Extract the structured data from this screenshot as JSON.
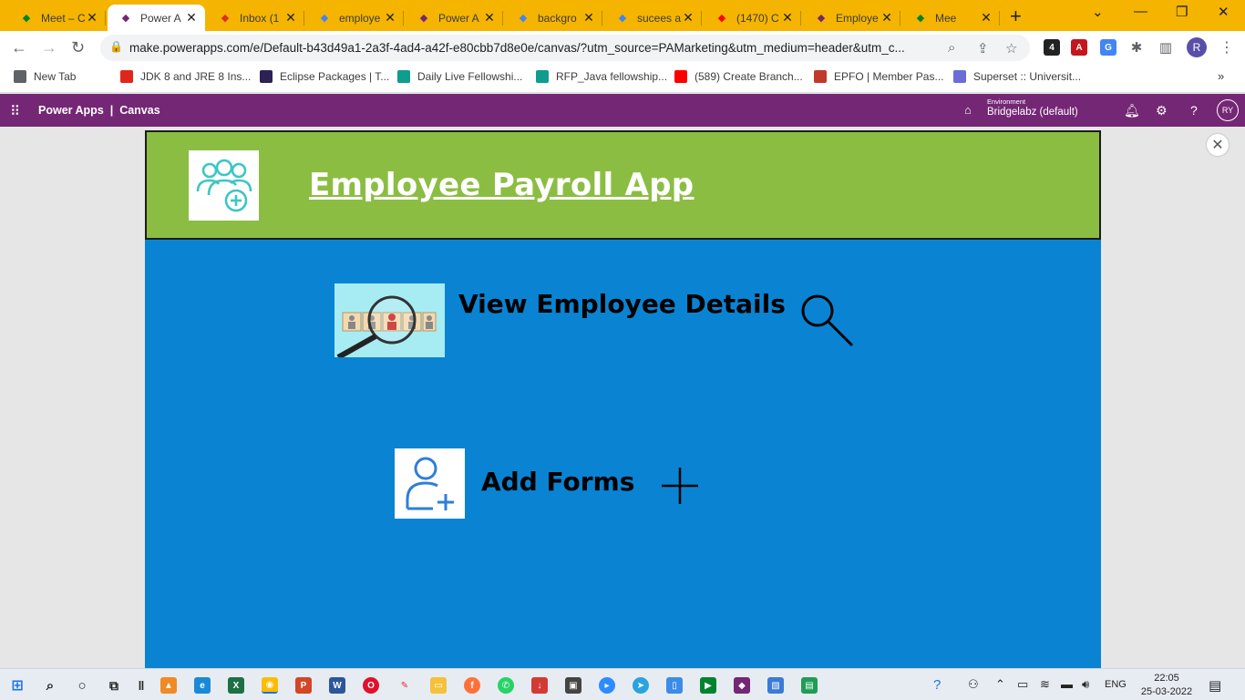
{
  "browser": {
    "tabs": [
      {
        "title": "Meet – C",
        "icon": "meet-icon",
        "color": "#00832d",
        "active": false
      },
      {
        "title": "Power A",
        "icon": "powerapps-icon",
        "color": "#742774",
        "active": true
      },
      {
        "title": "Inbox (1",
        "icon": "gmail-icon",
        "color": "#d93025",
        "active": false
      },
      {
        "title": "employe",
        "icon": "google-icon",
        "color": "#4285f4",
        "active": false
      },
      {
        "title": "Power A",
        "icon": "powerapps-icon",
        "color": "#742774",
        "active": false
      },
      {
        "title": "backgro",
        "icon": "google-icon",
        "color": "#4285f4",
        "active": false
      },
      {
        "title": "sucees a",
        "icon": "google-icon",
        "color": "#4285f4",
        "active": false
      },
      {
        "title": "(1470) C",
        "icon": "youtube-icon",
        "color": "#ff0000",
        "active": false
      },
      {
        "title": "Employe",
        "icon": "powerapps-icon",
        "color": "#742774",
        "active": false
      },
      {
        "title": "Mee",
        "icon": "meet-icon",
        "color": "#00832d",
        "active": false
      }
    ],
    "url": "make.powerapps.com/e/Default-b43d49a1-2a3f-4ad4-a42f-e80cbb7d8e0e/canvas/?utm_source=PAMarketing&utm_medium=header&utm_c...",
    "profile_initial": "R",
    "extension_badge": "4",
    "bookmarks": [
      {
        "label": "New Tab",
        "icon": "globe-icon",
        "color": "#5f6368"
      },
      {
        "label": "JDK 8 and JRE 8 Ins...",
        "icon": "oracle-icon",
        "color": "#e0261b"
      },
      {
        "label": "Eclipse Packages | T...",
        "icon": "eclipse-icon",
        "color": "#2c2255"
      },
      {
        "label": "Daily Live Fellowshi...",
        "icon": "classroom-icon",
        "color": "#0f9d8f"
      },
      {
        "label": "RFP_Java fellowship...",
        "icon": "classroom-icon",
        "color": "#0f9d8f"
      },
      {
        "label": "(589) Create Branch...",
        "icon": "youtube-icon",
        "color": "#ff0000"
      },
      {
        "label": "EPFO | Member Pas...",
        "icon": "epfo-icon",
        "color": "#c0392b"
      },
      {
        "label": "Superset :: Universit...",
        "icon": "superset-icon",
        "color": "#6c6cd9"
      }
    ]
  },
  "powerapps": {
    "brand": "Power Apps",
    "separator": "|",
    "mode": "Canvas",
    "environment_label": "Environment",
    "environment_name": "Bridgelabz (default)",
    "user_initials": "RY"
  },
  "app": {
    "title": "Employee Payroll App",
    "view_label": "View Employee Details",
    "add_label": "Add Forms",
    "header_color": "#8cbd43",
    "screen_color": "#0a84d2"
  },
  "taskbar": {
    "language": "ENG",
    "time": "22:05",
    "date": "25-03-2022"
  }
}
